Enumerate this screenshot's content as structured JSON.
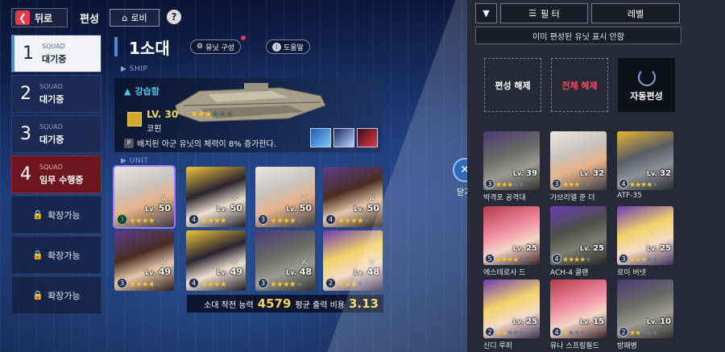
{
  "topbar": {
    "back_label": "뒤로",
    "title": "편성",
    "lobby_label": "로비",
    "help_label": "?"
  },
  "squads": [
    {
      "num": "1",
      "tag": "SQUAD",
      "status": "대기중",
      "state": "active"
    },
    {
      "num": "2",
      "tag": "SQUAD",
      "status": "대기중",
      "state": "idle"
    },
    {
      "num": "3",
      "tag": "SQUAD",
      "status": "대기중",
      "state": "idle"
    },
    {
      "num": "4",
      "tag": "SQUAD",
      "status": "임무 수행중",
      "state": "mission"
    }
  ],
  "locked_slots": [
    "확장가능",
    "확장가능",
    "확장가능"
  ],
  "squad_header": {
    "name": "1소대",
    "unit_config_label": "유닛 구성",
    "help_label": "도움말"
  },
  "ship_section_label": "SHIP",
  "unit_section_label": "UNIT",
  "ship": {
    "type": "강습함",
    "level": "LV. 30",
    "stars_filled": 3,
    "stars_total": 6,
    "name": "코핀",
    "desc_tag": "P",
    "description": "배치된 아군 유닛의 체력이 8% 증가한다."
  },
  "units": [
    {
      "level": "50",
      "rank": "3",
      "filled": 4,
      "total": 5,
      "palette": "silver",
      "selected": true
    },
    {
      "level": "50",
      "rank": "4",
      "filled": 4,
      "total": 5,
      "palette": "dark"
    },
    {
      "level": "50",
      "rank": "3",
      "filled": 4,
      "total": 5,
      "palette": "silver"
    },
    {
      "level": "50",
      "rank": "4",
      "filled": 4,
      "total": 5,
      "palette": "brown"
    },
    {
      "level": "49",
      "rank": "3",
      "filled": 4,
      "total": 5,
      "palette": "brown"
    },
    {
      "level": "49",
      "rank": "4",
      "filled": 4,
      "total": 5,
      "palette": "dark"
    },
    {
      "level": "48",
      "rank": "3",
      "filled": 4,
      "total": 5,
      "palette": "mech"
    },
    {
      "level": "48",
      "rank": "2",
      "filled": 3,
      "total": 5,
      "palette": "blonde"
    }
  ],
  "power": {
    "power_label": "소대 작전 능력",
    "power_value": "4579",
    "cost_label": "평균 출력 비용",
    "cost_value": "3.13"
  },
  "right": {
    "filter_label": "필 터",
    "sort_label": "레벨",
    "hide_label": "이미 편성된 유닛 표시 안함",
    "release_label": "편성 해제",
    "release_all_label": "전체 해제",
    "auto_label": "자동편성",
    "close_label": "닫기"
  },
  "roster": [
    {
      "name": "박격포 공격대",
      "level": "39",
      "rank": "3",
      "filled": 3,
      "total": 5,
      "palette": "mech"
    },
    {
      "name": "가브리엘 준 더",
      "level": "32",
      "rank": "3",
      "filled": 3,
      "total": 5,
      "palette": "silver"
    },
    {
      "name": "ATF-35",
      "level": "32",
      "rank": "4",
      "filled": 4,
      "total": 5,
      "palette": "jet"
    },
    {
      "name": "에스테로사 드",
      "level": "25",
      "rank": "5",
      "filled": 4,
      "total": 5,
      "palette": "pink"
    },
    {
      "name": "ACH-4 클랜",
      "level": "25",
      "rank": "4",
      "filled": 4,
      "total": 5,
      "palette": "heli"
    },
    {
      "name": "로이 버넷",
      "level": "25",
      "rank": "3",
      "filled": 3,
      "total": 5,
      "palette": "blonde"
    },
    {
      "name": "신디 루퍼",
      "level": "25",
      "rank": "2",
      "filled": 2,
      "total": 5,
      "palette": "blonde"
    },
    {
      "name": "유나 스프링필드",
      "level": "15",
      "rank": "4",
      "filled": 1,
      "total": 5,
      "palette": "pink"
    },
    {
      "name": "방패병",
      "level": "10",
      "rank": "2",
      "filled": 2,
      "total": 5,
      "palette": "mech"
    }
  ]
}
